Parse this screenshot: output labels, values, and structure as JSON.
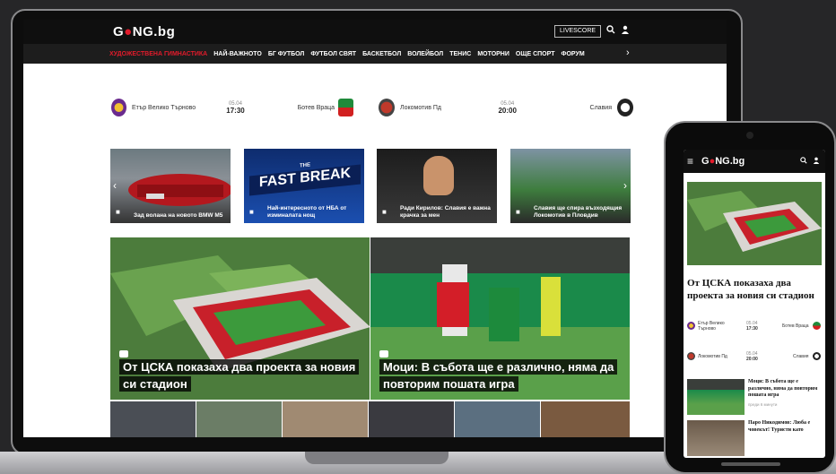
{
  "site": {
    "logo_prefix": "G",
    "logo_suffix": "NG.bg"
  },
  "header": {
    "livescore_label": "LIVESCORE",
    "search_icon": "search-icon",
    "user_icon": "user-icon"
  },
  "nav": {
    "items": [
      "ХУДОЖЕСТВЕНА ГИМНАСТИКА",
      "НАЙ-ВАЖНОТО",
      "БГ ФУТБОЛ",
      "ФУТБОЛ СВЯТ",
      "БАСКЕТБОЛ",
      "ВОЛЕЙБОЛ",
      "ТЕНИС",
      "МОТОРНИ",
      "ОЩЕ СПОРТ",
      "ФОРУМ"
    ],
    "more_icon": "chevron-right-icon"
  },
  "matches": [
    {
      "home": "Етър Велико Търново",
      "away": "Ботев Враца",
      "date": "05.04",
      "time": "17:30"
    },
    {
      "home": "Локомотив Пд",
      "away": "Славия",
      "date": "05.04",
      "time": "20:00"
    }
  ],
  "thumbs": [
    {
      "caption": "Зад волана на новото BMW M5"
    },
    {
      "caption": "Най-интересното от НБА от изминалата нощ",
      "overlay": "FAST BREAK",
      "overlay_small": "THE"
    },
    {
      "caption": "Ради Кирилов: Славия е важна крачка за мен"
    },
    {
      "caption": "Славия ще спира възходящия Локомотив в Пловдив"
    }
  ],
  "featured": [
    {
      "title": "От ЦСКА показаха два проекта за новия си стадион"
    },
    {
      "title": "Моци: В събота ще е различно, няма да повторим пошата игра"
    }
  ],
  "phone": {
    "logo_prefix": "G",
    "logo_suffix": "NG.bg",
    "headline": "От ЦСКА показаха два проекта за новия си стадион",
    "matches": [
      {
        "home": "Етър Велико Търново",
        "away": "Ботев Враца",
        "date": "05.04",
        "time": "17:30"
      },
      {
        "home": "Локомотив Пд",
        "away": "Славия",
        "date": "05.04",
        "time": "20:00"
      }
    ],
    "items": [
      {
        "title": "Моци: В събота ще е различно, няма да повторим пошата игра",
        "meta": "преди 6 минути"
      },
      {
        "title": "Паро Никодимов: Люба е човекът! Туристи като"
      }
    ]
  },
  "colors": {
    "accent": "#e21b2b",
    "header_bg": "#0f0f0f",
    "pitch": "#3c9a3c"
  }
}
